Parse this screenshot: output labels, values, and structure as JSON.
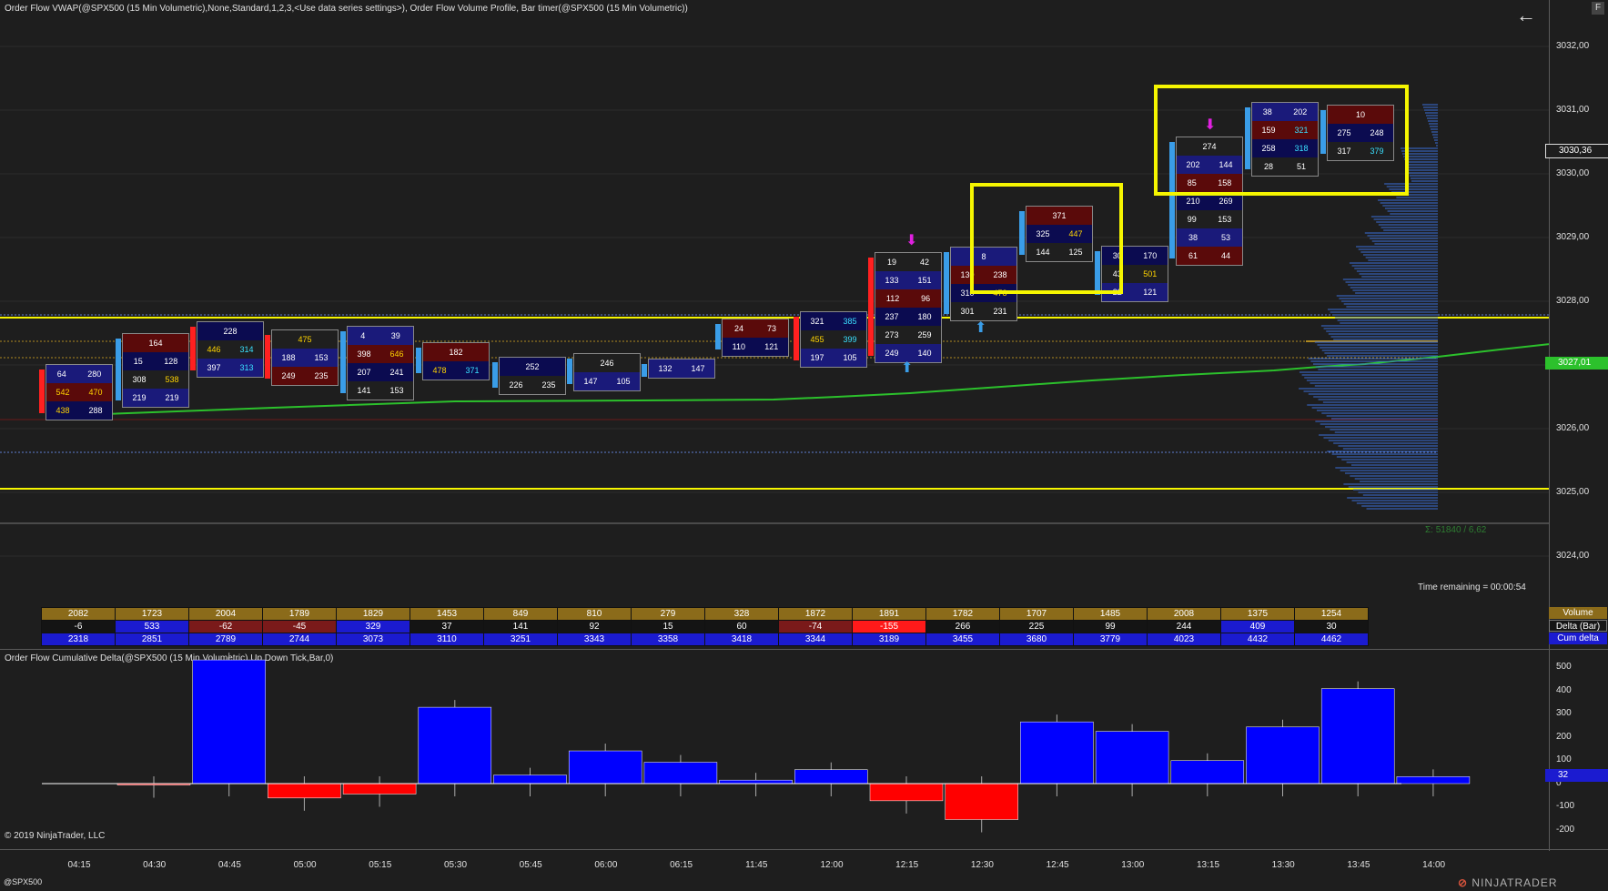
{
  "header": {
    "title": "Order Flow VWAP(@SPX500 (15 Min Volumetric),None,Standard,1,2,3,<Use data series settings>), Order Flow Volume Profile, Bar timer(@SPX500 (15 Min Volumetric))",
    "f_button": "F",
    "back_icon": "back-arrow-icon"
  },
  "price_axis": [
    "3032,00",
    "3031,00",
    "3030,00",
    "3029,00",
    "3028,00",
    "3027,00",
    "3026,00",
    "3025,00",
    "3024,00"
  ],
  "tags": {
    "last_price": "3030,36",
    "vwap": "3027,01",
    "delta": "32"
  },
  "status": {
    "time_remaining": "Time remaining = 00:00:54",
    "sigma": "Σ: 51840 / 6,62"
  },
  "summary": {
    "labels": [
      "Volume",
      "Delta (Bar)",
      "Cum delta"
    ],
    "volume": [
      "2082",
      "1723",
      "2004",
      "1789",
      "1829",
      "1453",
      "849",
      "810",
      "279",
      "328",
      "1872",
      "1891",
      "1782",
      "1707",
      "1485",
      "2008",
      "1375",
      "1254"
    ],
    "delta": [
      "-6",
      "533",
      "-62",
      "-45",
      "329",
      "37",
      "141",
      "92",
      "15",
      "60",
      "-74",
      "-155",
      "266",
      "225",
      "99",
      "244",
      "409",
      "30"
    ],
    "cum_delta": [
      "2318",
      "2851",
      "2789",
      "2744",
      "3073",
      "3110",
      "3251",
      "3343",
      "3358",
      "3418",
      "3344",
      "3189",
      "3455",
      "3680",
      "3779",
      "4023",
      "4432",
      "4462"
    ]
  },
  "cum_delta_panel": {
    "title": "Order Flow Cumulative Delta(@SPX500 (15 Min Volumetric),Up Down Tick,Bar,0)",
    "axis": [
      "500",
      "400",
      "300",
      "200",
      "100",
      "0",
      "-100",
      "-200"
    ]
  },
  "footer": {
    "copyright": "© 2019 NinjaTrader, LLC",
    "symbol": "@SPX500",
    "logo_prefix": "⊘",
    "logo_text": "NINJATRADER",
    "times": [
      "04:15",
      "04:30",
      "04:45",
      "05:00",
      "05:15",
      "05:30",
      "05:45",
      "06:00",
      "06:15",
      "11:45",
      "12:00",
      "12:15",
      "12:30",
      "12:45",
      "13:00",
      "13:15",
      "13:30",
      "13:45",
      "14:00"
    ]
  },
  "footprint_bars": [
    {
      "rows": [
        [
          "64",
          "280"
        ],
        [
          "542",
          "470"
        ],
        [
          "438",
          "288"
        ]
      ]
    },
    {
      "rows": [
        [
          "164"
        ],
        [
          "15",
          "128"
        ],
        [
          "308",
          "538"
        ],
        [
          "219",
          "219"
        ]
      ]
    },
    {
      "rows": [
        [
          "228"
        ],
        [
          "446",
          "314"
        ],
        [
          "397",
          "313"
        ]
      ]
    },
    {
      "rows": [
        [
          "475"
        ],
        [
          "188",
          "153"
        ],
        [
          "249",
          "235"
        ]
      ]
    },
    {
      "rows": [
        [
          "4",
          "39"
        ],
        [
          "398",
          "646"
        ],
        [
          "207",
          "241"
        ],
        [
          "141",
          "153"
        ]
      ]
    },
    {
      "rows": [
        [
          "182"
        ],
        [
          "478",
          "371"
        ]
      ]
    },
    {
      "rows": [
        [
          "252"
        ],
        [
          "226",
          "235"
        ]
      ]
    },
    {
      "rows": [
        [
          "246"
        ],
        [
          "147",
          "105"
        ]
      ]
    },
    {
      "rows": [
        [
          "132",
          "147"
        ]
      ]
    },
    {
      "rows": [
        [
          "24",
          "73"
        ],
        [
          "110",
          "121"
        ]
      ]
    },
    {
      "rows": [
        [
          "321",
          "385"
        ],
        [
          "455",
          "399"
        ],
        [
          "197",
          "105"
        ]
      ]
    },
    {
      "rows": [
        [
          "19",
          "42"
        ],
        [
          "133",
          "151"
        ],
        [
          "112",
          "96"
        ],
        [
          "237",
          "180"
        ],
        [
          "273",
          "259"
        ],
        [
          "249",
          "140"
        ]
      ]
    },
    {
      "rows": [
        [
          "8"
        ],
        [
          "130",
          "238"
        ],
        [
          "310",
          "478"
        ],
        [
          "301",
          "231"
        ]
      ]
    },
    {
      "rows": [
        [
          "371"
        ],
        [
          "325",
          "447"
        ],
        [
          "144",
          "125"
        ]
      ]
    },
    {
      "rows": [
        [
          "30",
          "170"
        ],
        [
          "43",
          "501"
        ],
        [
          "22",
          "121"
        ]
      ]
    },
    {
      "rows": [
        [
          "274"
        ],
        [
          "202",
          "144"
        ],
        [
          "85",
          "158"
        ],
        [
          "210",
          "269"
        ],
        [
          "99",
          "153"
        ],
        [
          "38",
          "53"
        ],
        [
          "61",
          "44"
        ]
      ]
    },
    {
      "rows": [
        [
          "38",
          "202"
        ],
        [
          "159",
          "321"
        ],
        [
          "258",
          "318"
        ],
        [
          "28",
          "51"
        ]
      ]
    },
    {
      "rows": [
        [
          "10"
        ],
        [
          "275",
          "248"
        ],
        [
          "317",
          "379"
        ]
      ]
    }
  ]
}
